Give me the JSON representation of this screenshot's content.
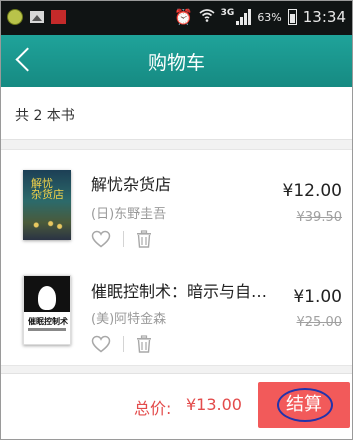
{
  "status_bar": {
    "network": "3G",
    "battery": "63%",
    "time": "13:34"
  },
  "header": {
    "title": "购物车"
  },
  "cart": {
    "count_text": "共 2 本书",
    "items": [
      {
        "title": "解忧杂货店",
        "author": "(日)东野圭吾",
        "price": "¥12.00",
        "original_price": "¥39.50",
        "cover_text": "解忧杂货店"
      },
      {
        "title": "催眠控制术：暗示与自…",
        "author": "(美)阿特金森",
        "price": "¥1.00",
        "original_price": "¥25.00",
        "cover_text": "催眠控制术"
      }
    ]
  },
  "footer": {
    "total_label": "总价:",
    "total_value": "¥13.00",
    "checkout_label": "结算"
  },
  "colors": {
    "header_teal": "#1b9a91",
    "accent_red": "#f25a5a",
    "price_red": "#e34b4b",
    "annotation_ring": "#2233aa"
  },
  "icons": {
    "back": "chevron-left-icon",
    "favorite": "heart-icon",
    "delete": "trash-icon"
  }
}
